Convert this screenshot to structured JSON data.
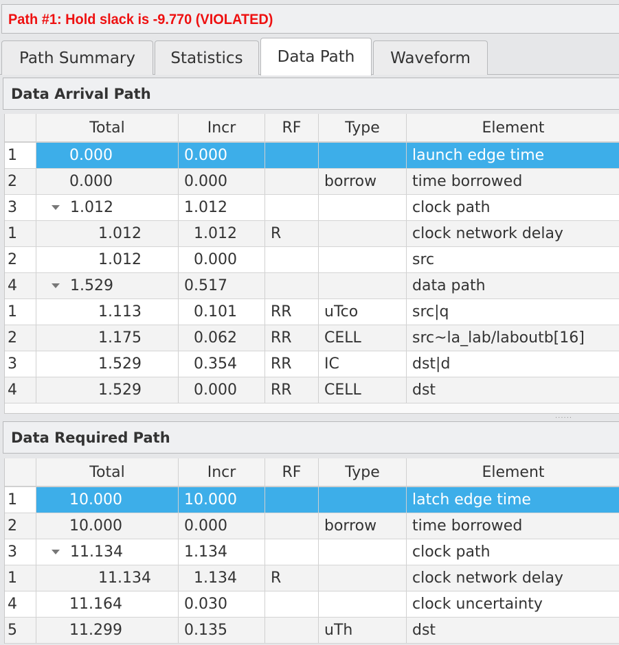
{
  "title": "Path #1: Hold slack is -9.770 (VIOLATED)",
  "tabs": [
    {
      "label": "Path Summary",
      "active": false
    },
    {
      "label": "Statistics",
      "active": false
    },
    {
      "label": "Data Path",
      "active": true
    },
    {
      "label": "Waveform",
      "active": false
    }
  ],
  "columns": [
    "Total",
    "Incr",
    "RF",
    "Type",
    "Element"
  ],
  "arrival": {
    "title": "Data Arrival Path",
    "rows": [
      {
        "n": "1",
        "level": 0,
        "expand": false,
        "total": "0.000",
        "incr": "0.000",
        "rf": "",
        "type": "",
        "element": "launch edge time",
        "selected": true
      },
      {
        "n": "2",
        "level": 0,
        "expand": false,
        "total": "0.000",
        "incr": "0.000",
        "rf": "",
        "type": "borrow",
        "element": "time borrowed"
      },
      {
        "n": "3",
        "level": 0,
        "expand": true,
        "total": "1.012",
        "incr": "1.012",
        "rf": "",
        "type": "",
        "element": "clock path"
      },
      {
        "n": "1",
        "level": 1,
        "total": "1.012",
        "incr": "1.012",
        "rf": "R",
        "type": "",
        "element": "clock network delay"
      },
      {
        "n": "2",
        "level": 1,
        "total": "1.012",
        "incr": "0.000",
        "rf": "",
        "type": "",
        "element": "src"
      },
      {
        "n": "4",
        "level": 0,
        "expand": true,
        "total": "1.529",
        "incr": "0.517",
        "rf": "",
        "type": "",
        "element": "data path"
      },
      {
        "n": "1",
        "level": 1,
        "total": "1.113",
        "incr": "0.101",
        "rf": "RR",
        "type": "uTco",
        "element": "src|q"
      },
      {
        "n": "2",
        "level": 1,
        "total": "1.175",
        "incr": "0.062",
        "rf": "RR",
        "type": "CELL",
        "element": "src~la_lab/laboutb[16]"
      },
      {
        "n": "3",
        "level": 1,
        "total": "1.529",
        "incr": "0.354",
        "rf": "RR",
        "type": "IC",
        "element": "dst|d"
      },
      {
        "n": "4",
        "level": 1,
        "total": "1.529",
        "incr": "0.000",
        "rf": "RR",
        "type": "CELL",
        "element": "dst"
      }
    ]
  },
  "required": {
    "title": "Data Required Path",
    "rows": [
      {
        "n": "1",
        "level": 0,
        "expand": false,
        "total": "10.000",
        "incr": "10.000",
        "rf": "",
        "type": "",
        "element": "latch edge time",
        "selected": true
      },
      {
        "n": "2",
        "level": 0,
        "expand": false,
        "total": "10.000",
        "incr": "0.000",
        "rf": "",
        "type": "borrow",
        "element": "time borrowed"
      },
      {
        "n": "3",
        "level": 0,
        "expand": true,
        "total": "11.134",
        "incr": "1.134",
        "rf": "",
        "type": "",
        "element": "clock path"
      },
      {
        "n": "1",
        "level": 1,
        "total": "11.134",
        "incr": "1.134",
        "rf": "R",
        "type": "",
        "element": "clock network delay"
      },
      {
        "n": "4",
        "level": 0,
        "expand": false,
        "total": "11.164",
        "incr": "0.030",
        "rf": "",
        "type": "",
        "element": "clock uncertainty"
      },
      {
        "n": "5",
        "level": 0,
        "expand": false,
        "total": "11.299",
        "incr": "0.135",
        "rf": "",
        "type": "uTh",
        "element": "dst"
      }
    ]
  },
  "colors": {
    "title_red": "#ee1111",
    "selection": "#3daee9"
  }
}
